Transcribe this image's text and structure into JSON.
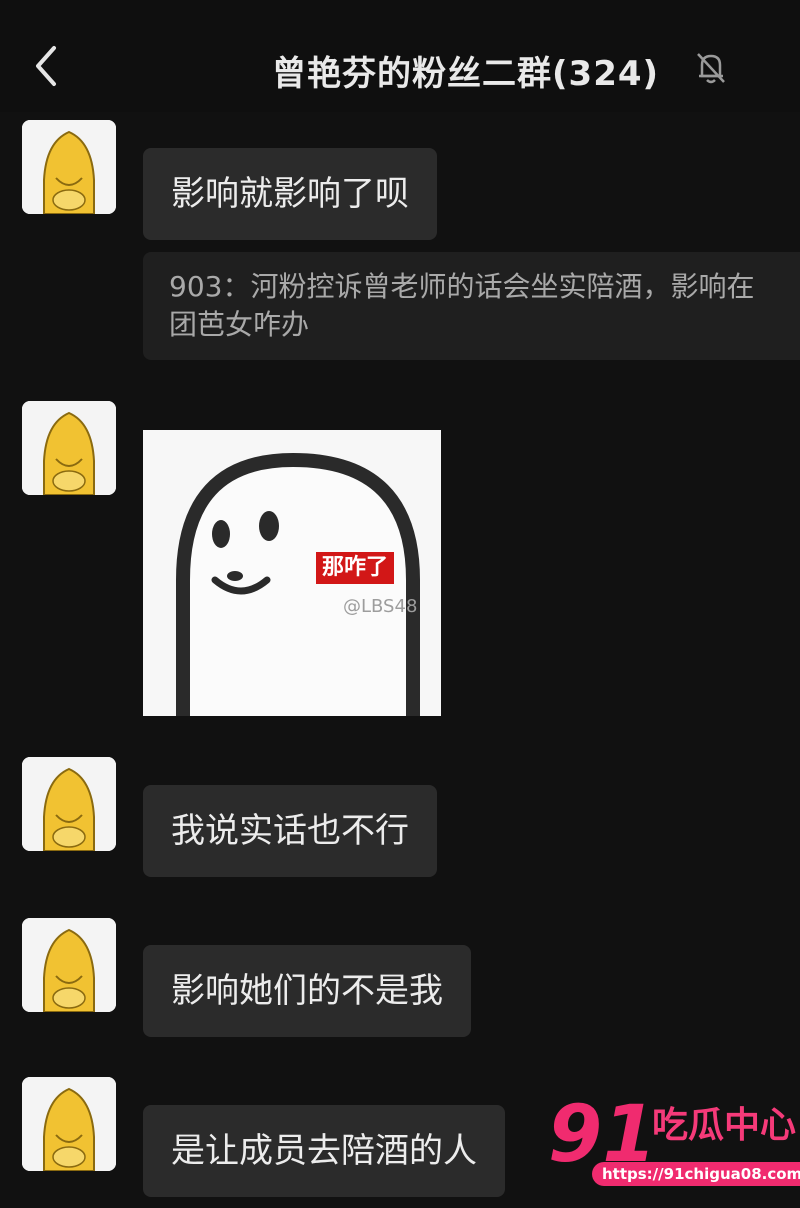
{
  "header": {
    "back_icon": "chevron-left-icon",
    "title": "曾艳芬的粉丝二群(324)",
    "mute_icon": "bell-off-icon"
  },
  "messages": [
    {
      "type": "text",
      "text": "影响就影响了呗"
    },
    {
      "type": "quote",
      "text": "903：河粉控诉曾老师的话会坐实陪酒，影响在团芭女咋办"
    },
    {
      "type": "sticker",
      "caption": "那咋了",
      "watermark": "@LBS48"
    },
    {
      "type": "text",
      "text": "我说实话也不行"
    },
    {
      "type": "text",
      "text": "影响她们的不是我"
    },
    {
      "type": "text",
      "text": "是让成员去陪酒的人"
    }
  ],
  "watermark": {
    "number": "91",
    "name": "吃瓜中心",
    "url": "https://91chigua08.com"
  },
  "colors": {
    "background": "#111111",
    "bubble": "#2b2b2b",
    "quote": "#1f1f1f",
    "accent": "#f02b6f"
  }
}
